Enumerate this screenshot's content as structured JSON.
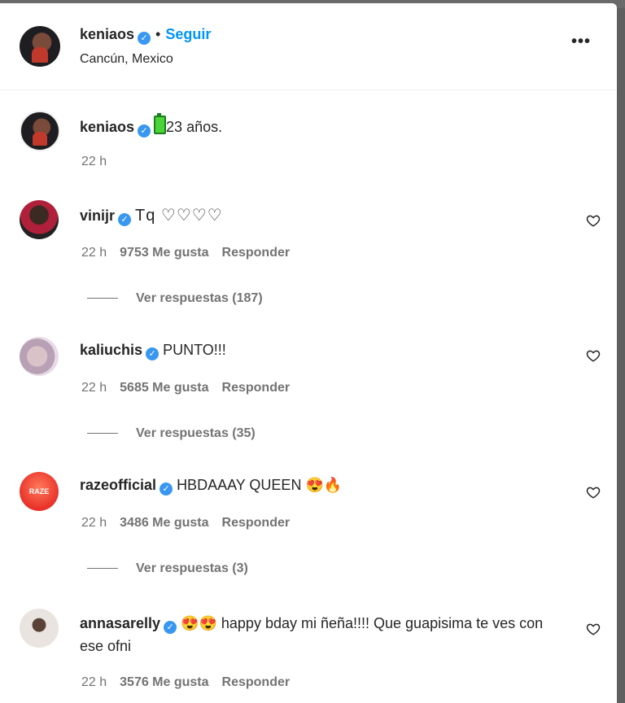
{
  "post": {
    "username": "keniaos",
    "follow_label": "Seguir",
    "location": "Cancún, Mexico"
  },
  "caption": {
    "username": "keniaos",
    "text": "23 años.",
    "time": "22 h"
  },
  "comments": [
    {
      "username": "vinijr",
      "text": "Tq ♡♡♡♡",
      "time": "22 h",
      "likes": "9753 Me gusta",
      "reply": "Responder",
      "view_replies": "Ver respuestas (187)"
    },
    {
      "username": "kaliuchis",
      "text": "PUNTO!!!",
      "time": "22 h",
      "likes": "5685 Me gusta",
      "reply": "Responder",
      "view_replies": "Ver respuestas (35)"
    },
    {
      "username": "razeofficial",
      "avatar_text": "RAZE",
      "text": "HBDAAAY QUEEN 😍🔥",
      "time": "22 h",
      "likes": "3486 Me gusta",
      "reply": "Responder",
      "view_replies": "Ver respuestas (3)"
    },
    {
      "username": "annasarelly",
      "text": "😍😍 happy bday mi ñeña!!!! Que guapisima te ves con ese ofni",
      "time": "22 h",
      "likes": "3576 Me gusta",
      "reply": "Responder"
    }
  ],
  "colors": {
    "accent": "#0095f6",
    "verified": "#3897f0",
    "muted": "#737373"
  }
}
